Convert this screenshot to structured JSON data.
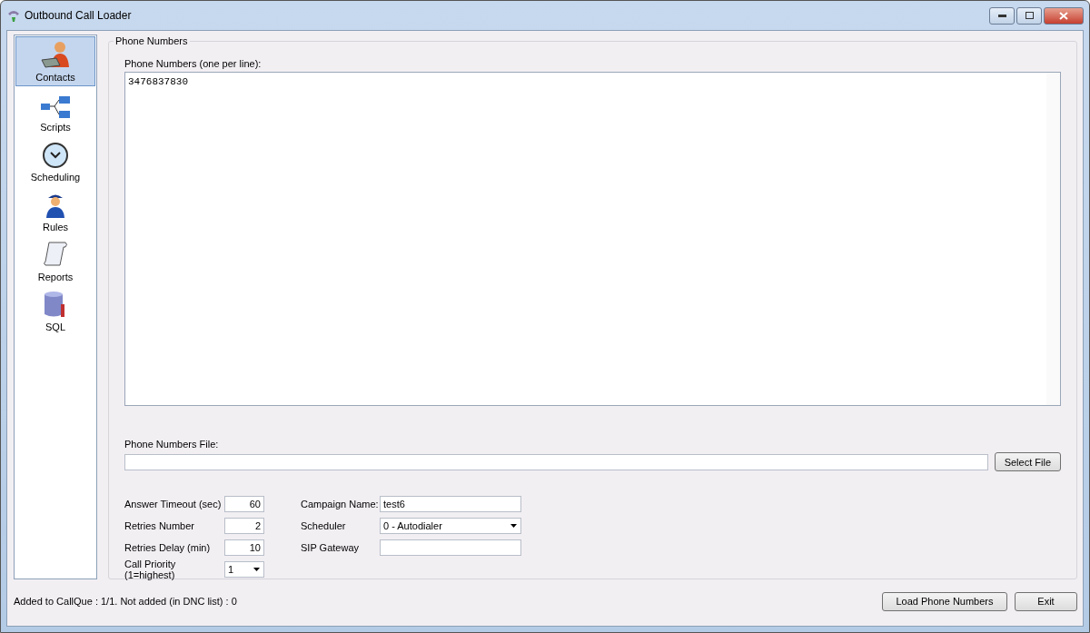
{
  "window": {
    "title": "Outbound Call Loader"
  },
  "sidebar": {
    "items": [
      {
        "label": "Contacts",
        "kind": "contacts",
        "selected": true
      },
      {
        "label": "Scripts",
        "kind": "scripts",
        "selected": false
      },
      {
        "label": "Scheduling",
        "kind": "scheduling",
        "selected": false
      },
      {
        "label": "Rules",
        "kind": "rules",
        "selected": false
      },
      {
        "label": "Reports",
        "kind": "reports",
        "selected": false
      },
      {
        "label": "SQL",
        "kind": "sql",
        "selected": false
      }
    ]
  },
  "group": {
    "title": "Phone Numbers",
    "numbers_label": "Phone Numbers (one per line):",
    "numbers_value": "3476837830",
    "file_label": "Phone Numbers File:",
    "select_file_button": "Select File",
    "left_fields": [
      {
        "label": "Answer Timeout (sec)",
        "value": "60",
        "kind": "number"
      },
      {
        "label": "Retries Number",
        "value": "2",
        "kind": "number"
      },
      {
        "label": "Retries Delay (min)",
        "value": "10",
        "kind": "number"
      },
      {
        "label": "Call Priority (1=highest)",
        "value": "1",
        "kind": "dropdown"
      }
    ],
    "right_fields": [
      {
        "label": "Campaign Name:",
        "value": "test6",
        "kind": "text"
      },
      {
        "label": "Scheduler",
        "value": "0 - Autodialer",
        "kind": "dropdown"
      },
      {
        "label": "SIP Gateway",
        "kind": "text"
      }
    ]
  },
  "status_bar": {
    "text": "Added to CallQue : 1/1. Not added (in DNC list) : 0",
    "buttons": [
      "Load Phone Numbers",
      "Exit"
    ]
  }
}
